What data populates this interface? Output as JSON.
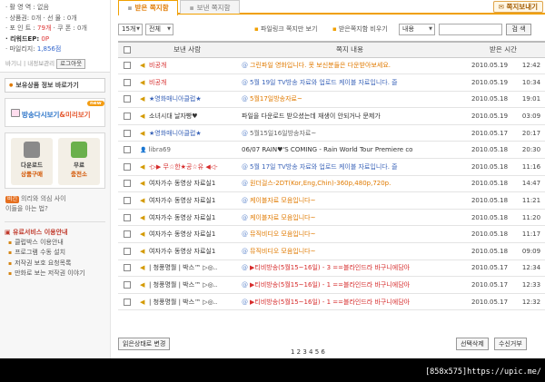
{
  "sidebar": {
    "stats": [
      {
        "label": "· 활 영 역 :",
        "value": "없음"
      },
      {
        "label": "· 상품권:",
        "value": "0개",
        "label2": "· 선 물 :",
        "value2": "0개"
      },
      {
        "label": "· 포 인 트 :",
        "value": "79개",
        "label2": "· 쿠 폰 :",
        "value2": "0개"
      },
      {
        "label": "· 리워드EP:",
        "value": "0P"
      },
      {
        "label": "· 마일리지:",
        "value": "1,856점"
      }
    ],
    "login_hint": "바기니 | 내정보관리",
    "logout_label": "로그아웃",
    "link_label": "보유상품 정보 바로가기",
    "banner_label_a": "방송다시보기",
    "banner_label_b": "&미리보기",
    "banner_new": "new",
    "download_box": {
      "l1": "다운로드",
      "l2": "상품구매"
    },
    "free_box": {
      "l1": "무료",
      "l2": "충전소"
    },
    "faq_tag": "비긴",
    "faq_line1": "의리와 의심 사이",
    "faq_line2": "이들을 아는 법?",
    "service_title": "▣ 유료서비스 이용안내",
    "service_items": [
      "클럽박스 이용안내",
      "프로그램 수동 설치",
      "저작권 보호 요청목록",
      "만화로 보는 저작권 이야기"
    ]
  },
  "tabs": {
    "received": "받은 쪽지함",
    "sent": "보낸 쪽지함",
    "write": "쪽지보내기"
  },
  "toolbar": {
    "count_select": "15개",
    "filter_select": "전체",
    "link_quick": "파일링크 쪽지만 보기",
    "link_empty": "받은쪽지함 비우기",
    "search_field_select": "내용",
    "search_value": "",
    "search_button": "검 색"
  },
  "table": {
    "headers": [
      "보낸 사람",
      "쪽지 내용",
      "받은 시간"
    ],
    "rows": [
      {
        "sender": "비공개",
        "sender_color": "red",
        "content": "그린파일 영화입니다. 못 보신분들은 다운받아보세요.",
        "content_color": "orange",
        "date": "2010.05.19",
        "time": "12:42",
        "icon": "speaker",
        "at": true
      },
      {
        "sender": "비공개",
        "sender_color": "red",
        "content": "5월 19일 TV방송 자료와 업로드 케이블 자료입니다. 즐",
        "content_color": "blue",
        "date": "2010.05.19",
        "time": "10:34",
        "icon": "speaker",
        "at": true
      },
      {
        "sender": "★영화매니아클럽★",
        "sender_color": "blue",
        "content": "5월17일방송자료~",
        "content_color": "orange",
        "date": "2010.05.18",
        "time": "19:01",
        "icon": "speaker",
        "at": true
      },
      {
        "sender": "소녀시대 날자빵♥",
        "sender_color": "dark",
        "content": "파일을 다운로드 받으셨는데 재생이 안되거나 문제가",
        "content_color": "dark",
        "date": "2010.05.19",
        "time": "03:09",
        "icon": "speaker",
        "at": false
      },
      {
        "sender": "★영화매니아클럽★",
        "sender_color": "blue",
        "content": "5월15일16일방송자료~",
        "content_color": "gray",
        "date": "2010.05.17",
        "time": "20:17",
        "icon": "speaker",
        "at": true
      },
      {
        "sender": "libra69",
        "sender_color": "gray",
        "content": "06/07 RAIN♥'S COMING - Rain World Tour Premiere co",
        "content_color": "dark",
        "date": "2010.05.18",
        "time": "20:30",
        "icon": "person",
        "at": false
      },
      {
        "sender": "-▷▶ 무☆한★공☆유 ◀◁-",
        "sender_color": "red",
        "content": "5월 17일 TV방송 자료와 업로드 케이블 자료입니다. 즐",
        "content_color": "blue",
        "date": "2010.05.18",
        "time": "11:16",
        "icon": "speaker",
        "at": true
      },
      {
        "sender": "여자가수 동영상 자료실1",
        "sender_color": "dark",
        "content": "원더걸스-2DT(Kor,Eng,Chin)-360p,480p,720p.",
        "content_color": "orange",
        "date": "2010.05.18",
        "time": "14:47",
        "icon": "speaker",
        "at": true
      },
      {
        "sender": "여자가수 동영상 자료실1",
        "sender_color": "dark",
        "content": "케이블자료 모음입니다~",
        "content_color": "orange",
        "date": "2010.05.18",
        "time": "11:21",
        "icon": "speaker",
        "at": true
      },
      {
        "sender": "여자가수 동영상 자료실1",
        "sender_color": "dark",
        "content": "케이블자료 모음입니다~",
        "content_color": "orange",
        "date": "2010.05.18",
        "time": "11:20",
        "icon": "speaker",
        "at": true
      },
      {
        "sender": "여자가수 동영상 자료실1",
        "sender_color": "dark",
        "content": "뮤직비디오 모음입니다~",
        "content_color": "orange",
        "date": "2010.05.18",
        "time": "11:17",
        "icon": "speaker",
        "at": true
      },
      {
        "sender": "여자가수 동영상 자료실1",
        "sender_color": "dark",
        "content": "뮤직비디오 모음입니다~",
        "content_color": "orange",
        "date": "2010.05.18",
        "time": "09:09",
        "icon": "speaker",
        "at": true
      },
      {
        "sender": "| 청풍명월 | 박스™ ▷◎..",
        "sender_color": "dark",
        "content": "▶티비방송(5월15~16일) - 3 ==블라인드라 바구니에담아",
        "content_color": "red",
        "date": "2010.05.17",
        "time": "12:34",
        "icon": "speaker",
        "at": true
      },
      {
        "sender": "| 청풍명월 | 박스™ ▷◎..",
        "sender_color": "dark",
        "content": "▶티비방송(5월15~16일) - 1 ==블라인드라 바구니에담아",
        "content_color": "red",
        "date": "2010.05.17",
        "time": "12:33",
        "icon": "speaker",
        "at": true
      },
      {
        "sender": "| 청풍명월 | 박스™ ▷◎..",
        "sender_color": "dark",
        "content": "▶티비방송(5월15~16일) - 1 ==블라인드라 바구니에담아",
        "content_color": "red",
        "date": "2010.05.17",
        "time": "12:32",
        "icon": "speaker",
        "at": true
      }
    ]
  },
  "bottom": {
    "mark_read": "읽은상태로 변경",
    "delete": "선택삭제",
    "reject": "수신거부",
    "pager": "1  2  3  4  5  6"
  },
  "watermark": "[858x575]https://upic.me/"
}
